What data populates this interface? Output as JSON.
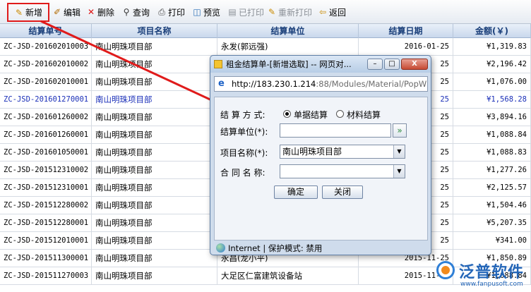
{
  "toolbar": {
    "new": "新增",
    "edit": "编辑",
    "delete": "删除",
    "query": "查询",
    "print": "打印",
    "preview": "预览",
    "printed": "已打印",
    "reprint": "重新打印",
    "back": "返回"
  },
  "columns": {
    "no": "结算单号",
    "project": "项目名称",
    "unit": "结算单位",
    "date": "结算日期",
    "amount": "金额(￥)"
  },
  "rows": [
    {
      "no": "ZC-JSD-201602010003",
      "project": "南山明珠项目部",
      "unit": "永发(郭远强)",
      "date": "2016-01-25",
      "amount": "¥1,319.83"
    },
    {
      "no": "ZC-JSD-201602010002",
      "project": "南山明珠项目部",
      "unit": "",
      "date": "25",
      "amount": "¥2,196.42"
    },
    {
      "no": "ZC-JSD-201602010001",
      "project": "南山明珠项目部",
      "unit": "",
      "date": "25",
      "amount": "¥1,076.00"
    },
    {
      "no": "ZC-JSD-201601270001",
      "project": "南山明珠项目部",
      "unit": "",
      "date": "25",
      "amount": "¥1,568.28"
    },
    {
      "no": "ZC-JSD-201601260002",
      "project": "南山明珠项目部",
      "unit": "",
      "date": "25",
      "amount": "¥3,894.16"
    },
    {
      "no": "ZC-JSD-201601260001",
      "project": "南山明珠项目部",
      "unit": "",
      "date": "25",
      "amount": "¥1,088.84"
    },
    {
      "no": "ZC-JSD-201601050001",
      "project": "南山明珠项目部",
      "unit": "",
      "date": "25",
      "amount": "¥1,088.83"
    },
    {
      "no": "ZC-JSD-201512310002",
      "project": "南山明珠项目部",
      "unit": "",
      "date": "25",
      "amount": "¥1,277.26"
    },
    {
      "no": "ZC-JSD-201512310001",
      "project": "南山明珠项目部",
      "unit": "",
      "date": "25",
      "amount": "¥2,125.57"
    },
    {
      "no": "ZC-JSD-201512280002",
      "project": "南山明珠项目部",
      "unit": "",
      "date": "25",
      "amount": "¥1,504.46"
    },
    {
      "no": "ZC-JSD-201512280001",
      "project": "南山明珠项目部",
      "unit": "",
      "date": "25",
      "amount": "¥5,207.35"
    },
    {
      "no": "ZC-JSD-201512010001",
      "project": "南山明珠项目部",
      "unit": "",
      "date": "25",
      "amount": "¥341.00"
    },
    {
      "no": "ZC-JSD-201511300001",
      "project": "南山明珠项目部",
      "unit": "永昌(龙小平)",
      "date": "2015-11-25",
      "amount": "¥1,850.89"
    },
    {
      "no": "ZC-JSD-201511270003",
      "project": "南山明珠项目部",
      "unit": "大足区仁富建筑设备站",
      "date": "2015-11-25",
      "amount": "¥1,088.84"
    }
  ],
  "dialog": {
    "title": "租金结算单-[新增选取] -- 网页对...",
    "url_host": "http://183.230.1.214",
    "url_rest": ":88/Modules/Material/PopW",
    "method_label": "结 算 方 式:",
    "method_opt1": "单据结算",
    "method_opt2": "材料结算",
    "unit_label": "结算单位(*):",
    "unit_value": "",
    "lookup_icon": "»",
    "project_label": "项目名称(*):",
    "project_value": "南山明珠项目部",
    "contract_label": "合 同 名 称:",
    "contract_value": "",
    "ok": "确定",
    "close": "关闭",
    "status": "Internet | 保护模式: 禁用",
    "btn_min": "–",
    "btn_max": "□",
    "btn_close": "X"
  },
  "watermark": {
    "name": "泛普软件",
    "site": "www.fanpusoft.com"
  },
  "colors": {
    "highlight": "#e01b1b",
    "selected_row_text": "#1a2fb8"
  }
}
